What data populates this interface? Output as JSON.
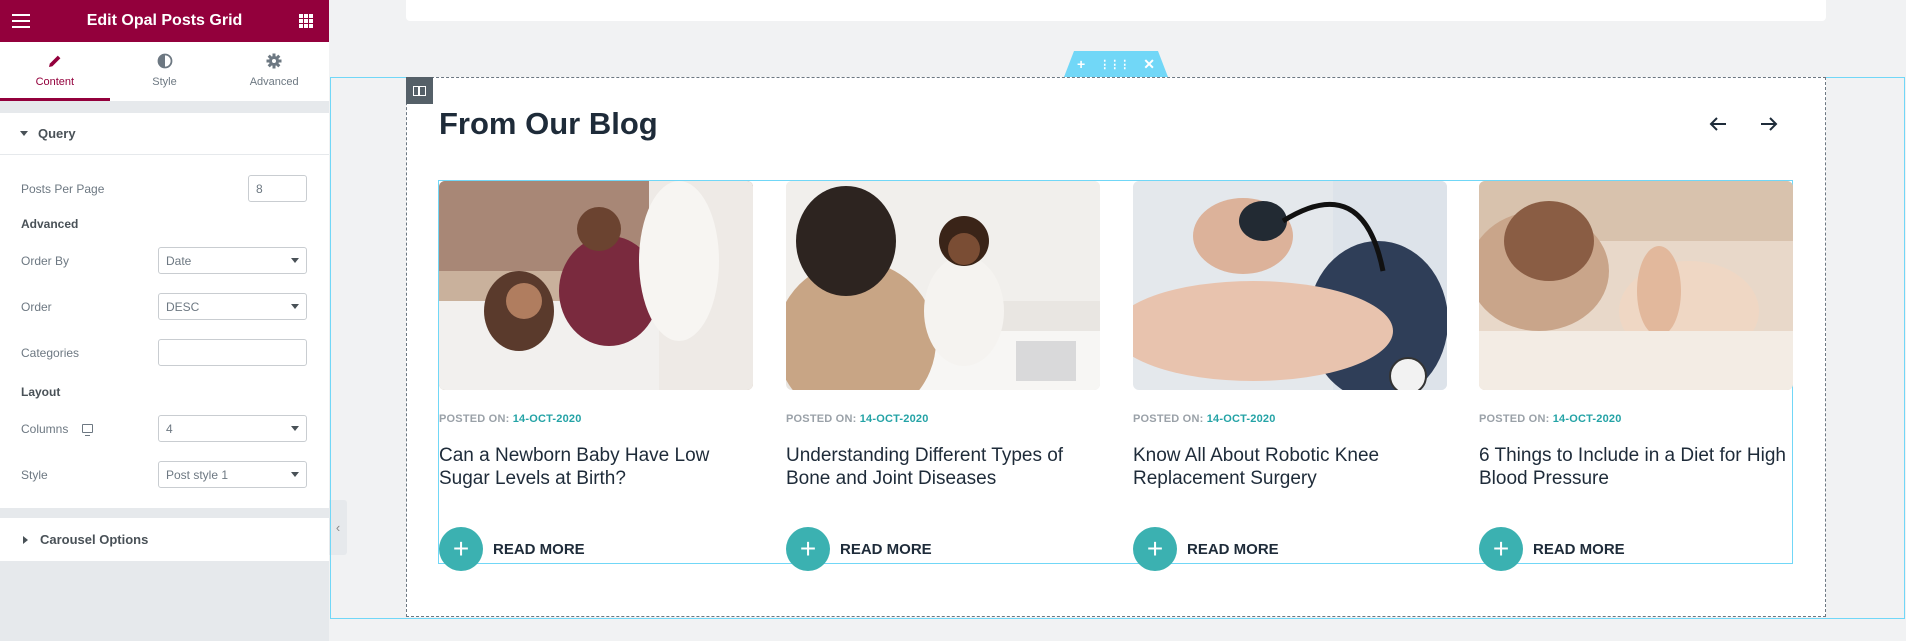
{
  "panel": {
    "title": "Edit Opal Posts Grid",
    "tabs": [
      {
        "label": "Content",
        "icon": "pencil-icon"
      },
      {
        "label": "Style",
        "icon": "half-circle-icon"
      },
      {
        "label": "Advanced",
        "icon": "gear-icon"
      }
    ],
    "query_section": "Query",
    "posts_per_page_label": "Posts Per Page",
    "posts_per_page_value": "8",
    "advanced_heading": "Advanced",
    "order_by_label": "Order By",
    "order_by_value": "Date",
    "order_label": "Order",
    "order_value": "DESC",
    "categories_label": "Categories",
    "categories_value": "",
    "layout_heading": "Layout",
    "columns_label": "Columns",
    "columns_value": "4",
    "style_label": "Style",
    "style_value": "Post style 1",
    "carousel_section": "Carousel Options"
  },
  "preview": {
    "section_title": "From Our Blog",
    "meta_prefix": "POSTED ON:",
    "read_more": "READ MORE",
    "posts": [
      {
        "date": "14-OCT-2020",
        "title": "Can a Newborn Baby Have Low Sugar Levels at Birth?"
      },
      {
        "date": "14-OCT-2020",
        "title": "Understanding Different Types of Bone and Joint Diseases"
      },
      {
        "date": "14-OCT-2020",
        "title": "Know All About Robotic Knee Replacement Surgery"
      },
      {
        "date": "14-OCT-2020",
        "title": "6 Things to Include in a Diet for High Blood Pressure"
      }
    ]
  },
  "colors": {
    "brand": "#93003c",
    "accent_teal": "#3bb1b1",
    "outline_blue": "#71d7f7"
  }
}
